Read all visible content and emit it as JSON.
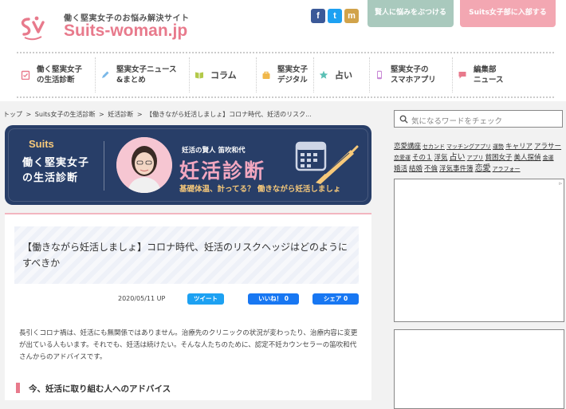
{
  "header": {
    "tagline": "働く堅実女子のお悩み解決サイト",
    "brand_name": "Suits",
    "brand_dash": "-",
    "brand_rest": "woman.jp",
    "social": {
      "facebook": "f",
      "twitter": "t",
      "mixi": "m"
    },
    "btn_consult": "賢人に悩みをぶつける",
    "btn_join": "Suits女子部に入部する"
  },
  "nav": [
    {
      "label": "働く堅実女子\nの生活診断",
      "icon": "clipboard-icon",
      "color": "#e87a8c"
    },
    {
      "label": "堅実女子ニュース\n&まとめ",
      "icon": "pencil-icon",
      "color": "#7ab8e8"
    },
    {
      "label": "コラム",
      "icon": "book-icon",
      "color": "#b3c94a"
    },
    {
      "label": "堅実女子\nデジタル",
      "icon": "bag-icon",
      "color": "#f0b74a"
    },
    {
      "label": "占い",
      "icon": "star-icon",
      "color": "#5bc0b5"
    },
    {
      "label": "堅実女子の\nスマホアプリ",
      "icon": "phone-icon",
      "color": "#c98ad6"
    },
    {
      "label": "編集部\nニュース",
      "icon": "chat-icon",
      "color": "#e87a8c"
    }
  ],
  "breadcrumb": {
    "items": [
      "トップ",
      "Suits女子の生活診断",
      "妊活診断",
      "【働きながら妊活しましょ】コロナ時代、妊活のリスク..."
    ],
    "sep": ">"
  },
  "banner": {
    "suits": "Suits",
    "title": "働く堅実女子\nの生活診断",
    "sub": "妊活の賢人 笛吹和代",
    "main": "妊活診断",
    "catch": "基礎体温、計ってる？ 働きながら妊活しましょ"
  },
  "article": {
    "title": "【働きながら妊活しましょ】コロナ時代、妊活のリスクヘッジはどのようにすべきか",
    "date": "2020/05/11 UP",
    "tweet": "ツイート",
    "like": "いいね！ 0",
    "share": "シェア 0",
    "body": "長引くコロナ禍は、妊活にも無関係ではありません。治療先のクリニックの状況が変わったり、治療内容に変更が出ている人もいます。それでも、妊活は続けたい。そんな人たちのために、認定不妊カウンセラーの笛吹和代さんからのアドバイスです。",
    "heading": "今、妊活に取り組む人へのアドバイス"
  },
  "sidebar": {
    "search_placeholder": "気になるワードをチェック",
    "tags": [
      {
        "t": "恋愛講座",
        "s": "m"
      },
      {
        "t": "セカンド",
        "s": "s"
      },
      {
        "t": "マッチングアプリ",
        "s": "s"
      },
      {
        "t": "運勢",
        "s": "s"
      },
      {
        "t": "キャリア",
        "s": "m"
      },
      {
        "t": "アラサー",
        "s": "m"
      },
      {
        "t": "恋愛運",
        "s": "s"
      },
      {
        "t": "その１",
        "s": "m"
      },
      {
        "t": "浮気",
        "s": "m"
      },
      {
        "t": "占い",
        "s": "l"
      },
      {
        "t": "アプリ",
        "s": "s"
      },
      {
        "t": "貧困女子",
        "s": "m"
      },
      {
        "t": "美人探偵",
        "s": "m"
      },
      {
        "t": "金運",
        "s": "s"
      },
      {
        "t": "婚活",
        "s": "m"
      },
      {
        "t": "結婚",
        "s": "m"
      },
      {
        "t": "不倫",
        "s": "m"
      },
      {
        "t": "浮気事件簿",
        "s": "m"
      },
      {
        "t": "恋愛",
        "s": "l"
      },
      {
        "t": "アラフォー",
        "s": "s"
      }
    ]
  }
}
